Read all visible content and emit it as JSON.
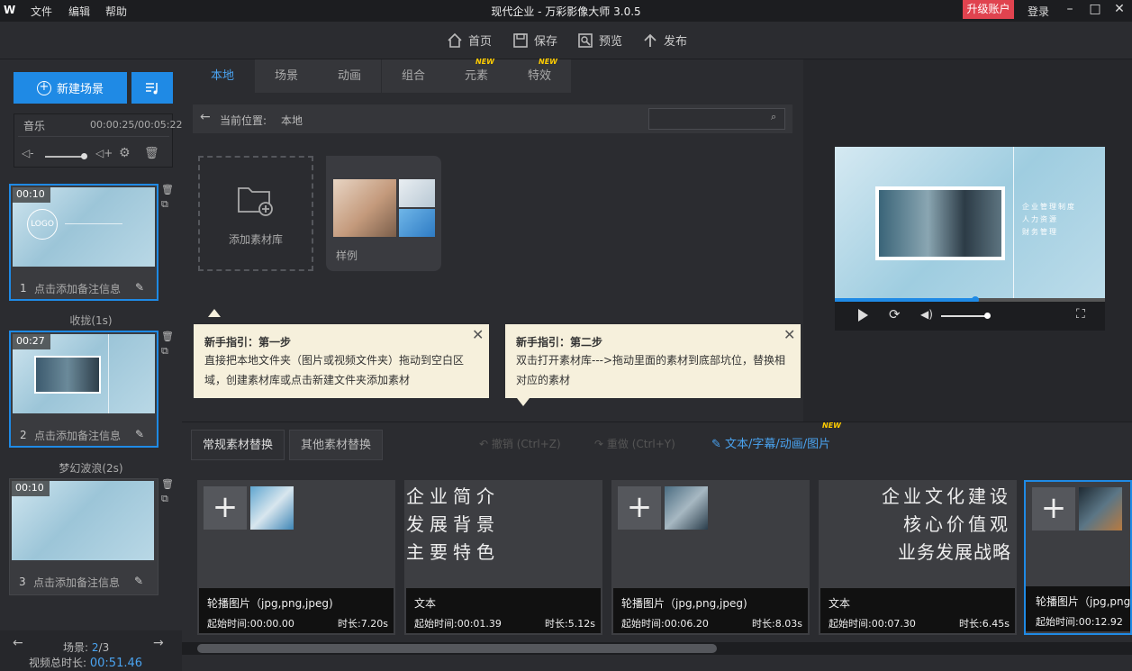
{
  "window": {
    "logo": "W",
    "menu": [
      "文件",
      "编辑",
      "帮助"
    ],
    "title": "现代企业 - 万彩影像大师 3.0.5",
    "upgrade": "升级账户",
    "login": "登录"
  },
  "toolbar": {
    "home": "首页",
    "save": "保存",
    "preview": "预览",
    "publish": "发布"
  },
  "left": {
    "new_scene": "新建场景",
    "music_label": "音乐",
    "music_time": "00:00:25/00:05:22",
    "scenes": [
      {
        "time": "00:10",
        "index": "1",
        "note": "点击添加备注信息",
        "logo": "LOGO"
      },
      {
        "time": "00:27",
        "index": "2",
        "note": "点击添加备注信息"
      },
      {
        "time": "00:10",
        "index": "3",
        "note": "点击添加备注信息"
      }
    ],
    "transitions": [
      "收拢(1s)",
      "梦幻波浪(2s)"
    ],
    "scene_label": "场景:",
    "scene_current": "2",
    "scene_sep": "/",
    "scene_total": "3",
    "total_label": "视频总时长:",
    "total_time": "00:51.46"
  },
  "library": {
    "tabs": [
      "本地",
      "场景",
      "动画",
      "组合",
      "元素",
      "特效"
    ],
    "new_badge": "NEW",
    "path_label": "当前位置:",
    "path_value": "本地",
    "search_placeholder": "",
    "add_library": "添加素材库",
    "sample": "样例"
  },
  "guides": [
    {
      "title": "新手指引：第一步",
      "text": "直接把本地文件夹（图片或视频文件夹）拖动到空白区域，创建素材库或点击新建文件夹添加素材"
    },
    {
      "title": "新手指引：第二步",
      "text": "双击打开素材库--->拖动里面的素材到底部坑位，替换相对应的素材"
    }
  ],
  "preview": {
    "progress": 0.52,
    "video_text": [
      "企业管理制度",
      "人力资源",
      "财务管理"
    ]
  },
  "bottom": {
    "tab_regular": "常规素材替换",
    "tab_other": "其他素材替换",
    "undo": "撤销 (Ctrl+Z)",
    "redo": "重做 (Ctrl+Y)",
    "text_link": "文本/字幕/动画/图片",
    "new_badge": "NEW",
    "items": [
      {
        "type": "轮播图片（jpg,png,jpeg)",
        "start": "起始时间:00:00.00",
        "duration": "时长:7.20s"
      },
      {
        "type": "文本",
        "lines": [
          "企业简介",
          "发展背景",
          "主要特色"
        ],
        "start": "起始时间:00:01.39",
        "duration": "时长:5.12s"
      },
      {
        "type": "轮播图片（jpg,png,jpeg)",
        "start": "起始时间:00:06.20",
        "duration": "时长:8.03s"
      },
      {
        "type": "文本",
        "lines": [
          "企业文化建设",
          "核心价值观",
          "业务发展战略"
        ],
        "start": "起始时间:00:07.30",
        "duration": "时长:6.45s"
      },
      {
        "type": "轮播图片（jpg,png,jpeg)",
        "start": "起始时间:00:12.92",
        "duration": ""
      }
    ]
  },
  "colors": {
    "accent": "#1f8ae5",
    "upgrade": "#e0434f",
    "guide_bg": "#f6f0dc",
    "new_badge": "#ffcc00"
  }
}
